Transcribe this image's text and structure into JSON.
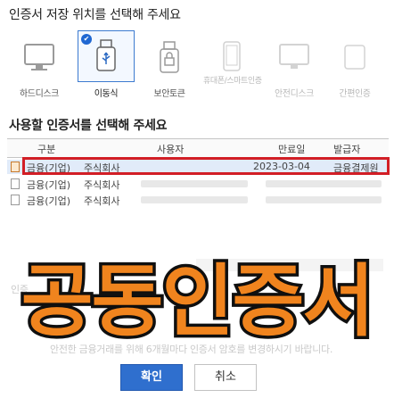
{
  "storage": {
    "title": "인증서 저장 위치를 선택해 주세요",
    "items": [
      {
        "label": "하드디스크",
        "icon": "monitor-icon"
      },
      {
        "label": "이동식",
        "icon": "usb-drive-icon"
      },
      {
        "label": "보안토큰",
        "icon": "security-token-icon"
      },
      {
        "label": "휴대폰/스마트인증",
        "icon": "phone-icon"
      },
      {
        "label": "안전디스크",
        "icon": "safe-disk-icon"
      },
      {
        "label": "간편인증",
        "icon": "simple-auth-icon"
      }
    ]
  },
  "certs": {
    "title": "사용할 인증서를 선택해 주세요",
    "columns": [
      "구분",
      "사용자",
      "만료일",
      "발급자"
    ],
    "rows": [
      {
        "type": "금융(기업)",
        "user": "주식회사",
        "expiry": "2023-03-04",
        "issuer": "금융결제원"
      },
      {
        "type": "금융(기업)",
        "user": "주식회사",
        "expiry": "",
        "issuer": ""
      },
      {
        "type": "금융(기업)",
        "user": "주식회사",
        "expiry": "",
        "issuer": ""
      }
    ]
  },
  "faint": {
    "hint": "안전한 금융거래를 위해 6개월마다 인증서 암호를 변경하시기 바랍니다.",
    "section": "인증"
  },
  "overlay": {
    "text": "공동인증서"
  },
  "buttons": {
    "ok": "확인",
    "cancel": "취소"
  }
}
